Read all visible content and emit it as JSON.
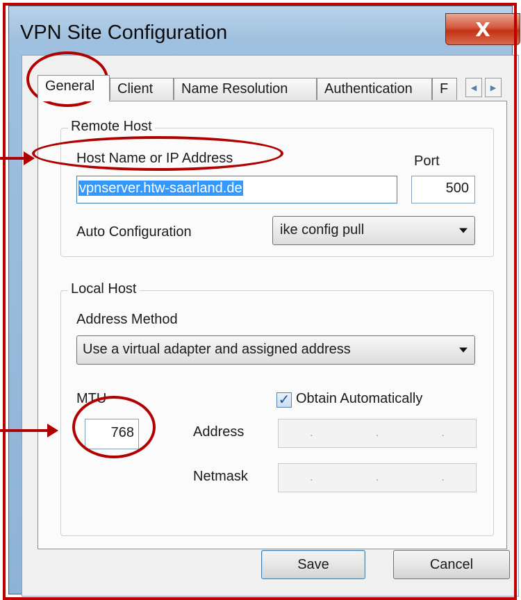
{
  "window": {
    "title": "VPN Site Configuration",
    "close_glyph": "X"
  },
  "tabs": [
    {
      "label": "General",
      "active": true
    },
    {
      "label": "Client"
    },
    {
      "label": "Name Resolution"
    },
    {
      "label": "Authentication"
    },
    {
      "label": "F"
    }
  ],
  "tab_scroll": {
    "left": "◀",
    "right": "▶"
  },
  "remote_host": {
    "group_label": "Remote Host",
    "host_label": "Host Name or IP Address",
    "host_value": "vpnserver.htw-saarland.de",
    "port_label": "Port",
    "port_value": "500",
    "auto_config_label": "Auto Configuration",
    "auto_config_value": "ike config pull"
  },
  "local_host": {
    "group_label": "Local Host",
    "address_method_label": "Address Method",
    "address_method_value": "Use a virtual adapter and assigned address",
    "mtu_label": "MTU",
    "mtu_value": "768",
    "obtain_auto_label": "Obtain Automatically",
    "obtain_auto_checked": true,
    "address_label": "Address",
    "netmask_label": "Netmask",
    "ip_dot": "."
  },
  "buttons": {
    "save": "Save",
    "cancel": "Cancel"
  },
  "colors": {
    "annotation": "#b00000",
    "selection": "#3399ff"
  }
}
